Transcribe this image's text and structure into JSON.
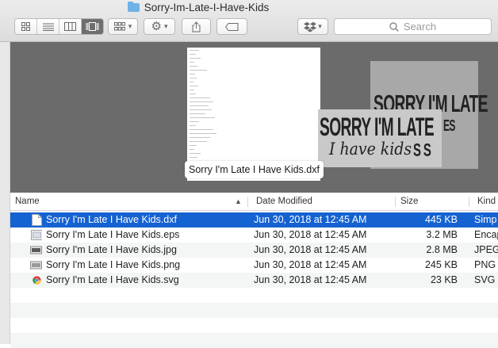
{
  "window": {
    "title": "Sorry-Im-Late-I-Have-Kids"
  },
  "toolbar": {
    "view_buttons": [
      "icon-view",
      "list-view",
      "column-view",
      "cover-flow-view"
    ],
    "active_view": "cover-flow-view",
    "search": {
      "placeholder": "Search"
    }
  },
  "preview": {
    "caption": "Sorry I'm Late I Have Kids.dxf",
    "artwork_line1": "SORRY I'M LATE",
    "artwork_line2": "SORRY I'M LATE",
    "artwork_line3": "I have kids",
    "artwork_tail": "ES",
    "artwork_tail2": "S S"
  },
  "list": {
    "columns": {
      "name": "Name",
      "date": "Date Modified",
      "size": "Size",
      "kind": "Kind"
    },
    "files": [
      {
        "name": "Sorry I'm Late I Have Kids.dxf",
        "date": "Jun 30, 2018 at 12:45 AM",
        "size": "445 KB",
        "kind": "Simp"
      },
      {
        "name": "Sorry I'm Late I Have Kids.eps",
        "date": "Jun 30, 2018 at 12:45 AM",
        "size": "3.2 MB",
        "kind": "Encap"
      },
      {
        "name": "Sorry I'm Late I Have Kids.jpg",
        "date": "Jun 30, 2018 at 12:45 AM",
        "size": "2.8 MB",
        "kind": "JPEG"
      },
      {
        "name": "Sorry I'm Late I Have Kids.png",
        "date": "Jun 30, 2018 at 12:45 AM",
        "size": "245 KB",
        "kind": "PNG"
      },
      {
        "name": "Sorry I'm Late I Have Kids.svg",
        "date": "Jun 30, 2018 at 12:45 AM",
        "size": "23 KB",
        "kind": "SVG d"
      }
    ]
  },
  "colors": {
    "selection": "#1562d1",
    "preview_bg": "#6b6b6b",
    "folder": "#6fb2e6"
  }
}
